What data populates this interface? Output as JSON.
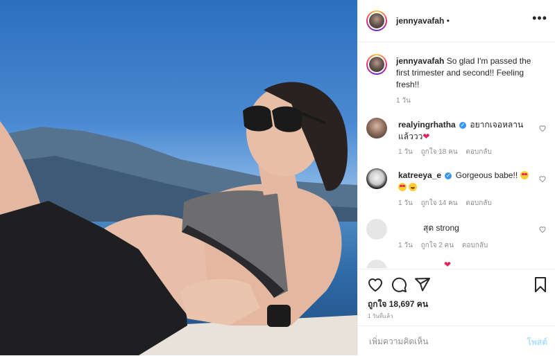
{
  "header": {
    "username": "jennyavafah",
    "separator": "•",
    "more_icon": "more-dots-icon"
  },
  "caption": {
    "username": "jennyavafah",
    "text": "So glad I'm passed the first trimester and second!! Feeling fresh!!",
    "time": "1 วัน"
  },
  "comments": [
    {
      "username": "realyingrhatha",
      "verified": true,
      "text": "อยากเจอหลานแล้ววว",
      "emoji": "heart",
      "time": "1 วัน",
      "likes": "ถูกใจ 18 คน",
      "reply": "ตอบกลับ"
    },
    {
      "username": "katreeya_e",
      "verified": true,
      "text": "Gorgeous babe!!",
      "emoji": "heart-eyes grin",
      "time": "1 วัน",
      "likes": "ถูกใจ 14 คน",
      "reply": "ตอบกลับ"
    },
    {
      "username": "สุด",
      "verified": false,
      "text": "strong",
      "time": "1 วัน",
      "likes": "ถูกใจ 2 คน",
      "reply": "ตอบกลับ"
    }
  ],
  "actions": {
    "icons": [
      "heart-icon",
      "comment-icon",
      "share-icon",
      "bookmark-icon"
    ]
  },
  "likes": "ถูกใจ 18,697 คน",
  "posted": "1 วันที่แล้ว",
  "add_comment": {
    "placeholder": "เพิ่มความคิดเห็น",
    "post_label": "โพสต์"
  },
  "colors": {
    "accent": "#3897f0",
    "post_disabled": "#b2dffc",
    "heart": "#e0245e"
  }
}
